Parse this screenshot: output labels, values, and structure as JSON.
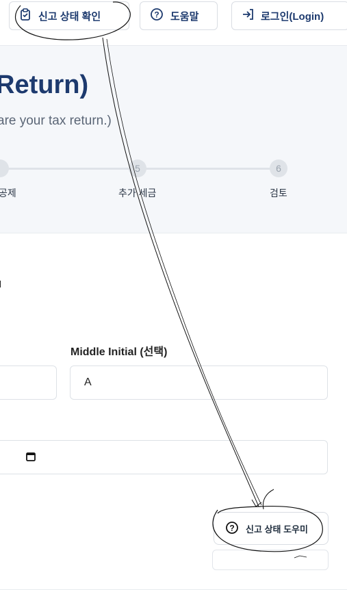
{
  "topbar": {
    "status_label": "신고 상태 확인",
    "help_label": "도움말",
    "login_label": "로그인(Login)"
  },
  "hero": {
    "title": "Return)",
    "subtitle": "are your tax return.)"
  },
  "stepper": {
    "steps": [
      {
        "number": "",
        "label": "공제"
      },
      {
        "number": "5",
        "label": "추가 세금"
      },
      {
        "number": "6",
        "label": "검토"
      }
    ]
  },
  "form": {
    "middle_initial_label": "Middle Initial (선택)",
    "middle_initial_value": "A"
  },
  "helper": {
    "label": "신고 상태 도우미"
  },
  "colors": {
    "brand": "#1d3a6e",
    "hero_bg": "#f5f7fa",
    "border": "#d9dde3"
  },
  "icons": {
    "status": "clipboard-check-icon",
    "help": "question-circle-icon",
    "login": "login-arrow-icon",
    "calendar": "calendar-icon"
  }
}
